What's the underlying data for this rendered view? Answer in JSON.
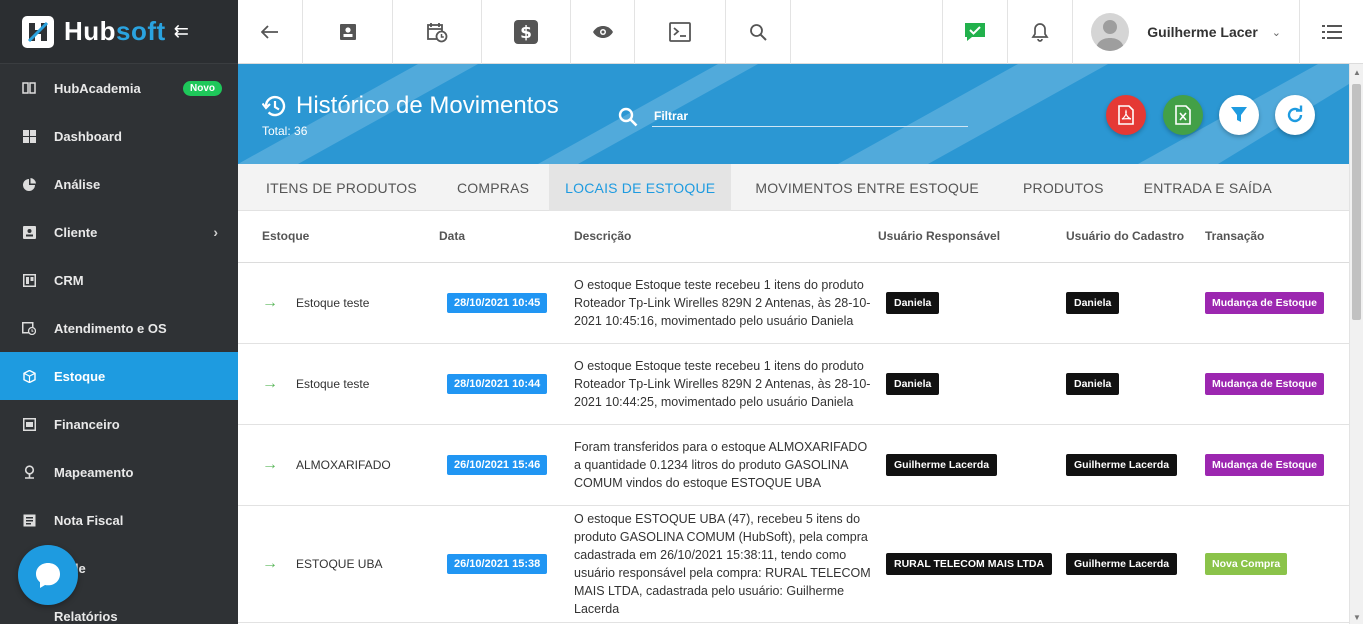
{
  "brand": {
    "name_a": "Hub",
    "name_b": "soft"
  },
  "sidebar": {
    "items": [
      {
        "label": "HubAcademia",
        "icon": "book-icon",
        "badge": "Novo"
      },
      {
        "label": "Dashboard",
        "icon": "grid-icon"
      },
      {
        "label": "Análise",
        "icon": "pie-chart-icon"
      },
      {
        "label": "Cliente",
        "icon": "contact-card-icon"
      },
      {
        "label": "CRM",
        "icon": "kanban-icon"
      },
      {
        "label": "Atendimento e OS",
        "icon": "calendar-clock-icon"
      },
      {
        "label": "Estoque",
        "icon": "box-icon"
      },
      {
        "label": "Financeiro",
        "icon": "money-icon"
      },
      {
        "label": "Mapeamento",
        "icon": "map-pin-icon"
      },
      {
        "label": "Nota Fiscal",
        "icon": "invoice-icon"
      },
      {
        "label": "Rede",
        "icon": "network-icon"
      },
      {
        "label": "Relatórios",
        "icon": "report-icon"
      }
    ]
  },
  "topbar": {
    "user_name": "Guilherme Lacer"
  },
  "header": {
    "title": "Histórico de Movimentos",
    "total": "Total: 36",
    "filter_placeholder": "Filtrar"
  },
  "tabs": [
    {
      "label": "ITENS DE PRODUTOS",
      "active": false
    },
    {
      "label": "COMPRAS",
      "active": false
    },
    {
      "label": "LOCAIS DE ESTOQUE",
      "active": true
    },
    {
      "label": "MOVIMENTOS ENTRE ESTOQUE",
      "active": false
    },
    {
      "label": "PRODUTOS",
      "active": false
    },
    {
      "label": "ENTRADA E SAÍDA",
      "active": false
    }
  ],
  "table": {
    "columns": [
      "Estoque",
      "Data",
      "Descrição",
      "Usuário Responsável",
      "Usuário do Cadastro",
      "Transação"
    ],
    "rows": [
      {
        "estoque": "Estoque teste",
        "data": "28/10/2021 10:45",
        "descricao": "O estoque Estoque teste recebeu 1 itens do produto Roteador Tp-Link Wirelles 829N 2 Antenas, às 28-10-2021 10:45:16, movimentado pelo usuário Daniela",
        "usuario_responsavel": "Daniela",
        "usuario_cadastro": "Daniela",
        "transacao": "Mudança de Estoque"
      },
      {
        "estoque": "Estoque teste",
        "data": "28/10/2021 10:44",
        "descricao": "O estoque Estoque teste recebeu 1 itens do produto Roteador Tp-Link Wirelles 829N 2 Antenas, às 28-10-2021 10:44:25, movimentado pelo usuário Daniela",
        "usuario_responsavel": "Daniela",
        "usuario_cadastro": "Daniela",
        "transacao": "Mudança de Estoque"
      },
      {
        "estoque": "ALMOXARIFADO",
        "data": "26/10/2021 15:46",
        "descricao": "Foram transferidos para o estoque ALMOXARIFADO a quantidade 0.1234 litros do produto GASOLINA COMUM vindos do estoque ESTOQUE UBA",
        "usuario_responsavel": "Guilherme Lacerda",
        "usuario_cadastro": "Guilherme Lacerda",
        "transacao": "Mudança de Estoque"
      },
      {
        "estoque": "ESTOQUE UBA",
        "data": "26/10/2021 15:38",
        "descricao": "O estoque ESTOQUE UBA (47), recebeu 5 itens do produto GASOLINA COMUM (HubSoft), pela compra cadastrada em 26/10/2021 15:38:11, tendo como usuário responsável pela compra: RURAL TELECOM MAIS LTDA, cadastrada pelo usuário: Guilherme Lacerda",
        "usuario_responsavel": "RURAL TELECOM MAIS LTDA",
        "usuario_cadastro": "Guilherme Lacerda",
        "transacao": "Nova Compra"
      }
    ]
  },
  "colors": {
    "sidebar_bg": "#2f3235",
    "accent": "#1e9be0",
    "header_bg": "#2b97d3",
    "date_badge": "#2196f3",
    "tx_mudanca": "#9c27b0",
    "tx_compra": "#8bc34a",
    "badge_novo": "#1ec85a",
    "fab_pdf": "#e53935",
    "fab_excel": "#43a047"
  }
}
